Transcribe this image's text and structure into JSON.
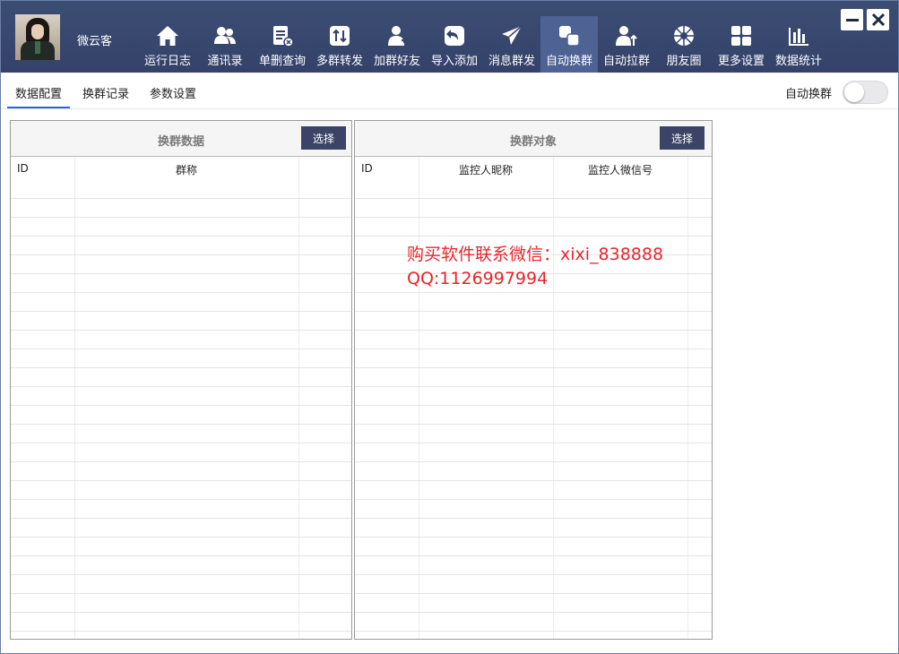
{
  "header": {
    "username": "微云客",
    "nav": [
      {
        "label": "运行日志",
        "icon": "home-icon",
        "active": false
      },
      {
        "label": "通讯录",
        "icon": "contacts-icon",
        "active": false
      },
      {
        "label": "单删查询",
        "icon": "delete-check-icon",
        "active": false
      },
      {
        "label": "多群转发",
        "icon": "forward-icon",
        "active": false
      },
      {
        "label": "加群好友",
        "icon": "add-friend-icon",
        "active": false
      },
      {
        "label": "导入添加",
        "icon": "import-icon",
        "active": false
      },
      {
        "label": "消息群发",
        "icon": "send-icon",
        "active": false
      },
      {
        "label": "自动换群",
        "icon": "switch-group-icon",
        "active": true
      },
      {
        "label": "自动拉群",
        "icon": "pull-group-icon",
        "active": false
      },
      {
        "label": "朋友圈",
        "icon": "moments-icon",
        "active": false
      },
      {
        "label": "更多设置",
        "icon": "grid-icon",
        "active": false
      },
      {
        "label": "数据统计",
        "icon": "bar-chart-icon",
        "active": false
      }
    ]
  },
  "tabs": [
    {
      "label": "数据配置",
      "active": true
    },
    {
      "label": "换群记录",
      "active": false
    },
    {
      "label": "参数设置",
      "active": false
    }
  ],
  "auto_switch": {
    "label": "自动换群",
    "on": false
  },
  "left_panel": {
    "title": "换群数据",
    "button": "选择",
    "columns": [
      "ID",
      "群称"
    ]
  },
  "right_panel": {
    "title": "换群对象",
    "button": "选择",
    "columns": [
      "ID",
      "监控人昵称",
      "监控人微信号"
    ]
  },
  "watermark": {
    "line1": "购买软件联系微信：xixi_838888",
    "line2": "QQ:1126997994"
  },
  "colors": {
    "header_bg": "#34426a",
    "active_nav": "#4f6294",
    "button_bg": "#3b4467",
    "tab_underline": "#2b63d9",
    "watermark": "#e8262b"
  }
}
